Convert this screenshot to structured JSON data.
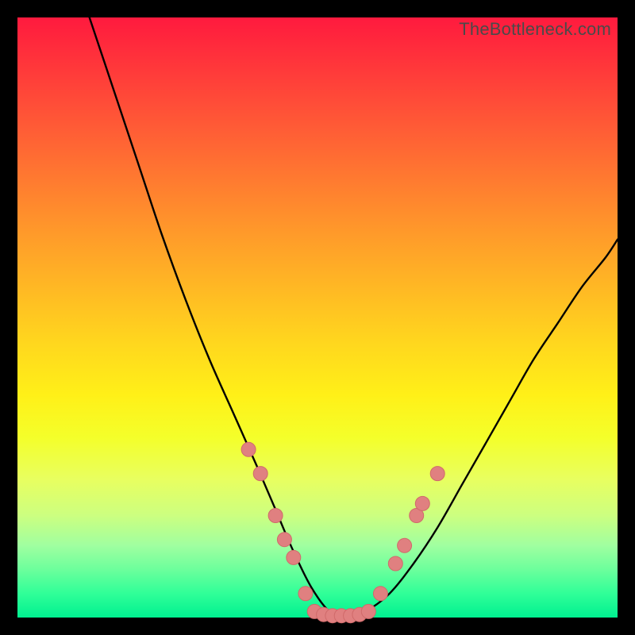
{
  "watermark": "TheBottleneck.com",
  "colors": {
    "curve_stroke": "#000000",
    "marker_fill": "#e08080",
    "marker_stroke": "#d06a6a",
    "frame_bg": "#000000"
  },
  "chart_data": {
    "type": "line",
    "title": "",
    "xlabel": "",
    "ylabel": "",
    "xlim": [
      0,
      100
    ],
    "ylim": [
      0,
      100
    ],
    "series": [
      {
        "name": "bottleneck-curve",
        "x": [
          12,
          16,
          20,
          24,
          28,
          32,
          36,
          40,
          43,
          46,
          49,
          52,
          55,
          58,
          62,
          66,
          70,
          74,
          78,
          82,
          86,
          90,
          94,
          98,
          100
        ],
        "y": [
          100,
          88,
          76,
          64,
          53,
          43,
          34,
          25,
          18,
          11,
          5,
          1,
          0,
          1,
          4,
          9,
          15,
          22,
          29,
          36,
          43,
          49,
          55,
          60,
          63
        ]
      }
    ],
    "markers": [
      {
        "x": 38.5,
        "y": 28
      },
      {
        "x": 40.5,
        "y": 24
      },
      {
        "x": 43.0,
        "y": 17
      },
      {
        "x": 44.5,
        "y": 13
      },
      {
        "x": 46.0,
        "y": 10
      },
      {
        "x": 48.0,
        "y": 4
      },
      {
        "x": 49.5,
        "y": 1
      },
      {
        "x": 51.0,
        "y": 0.5
      },
      {
        "x": 52.5,
        "y": 0.3
      },
      {
        "x": 54.0,
        "y": 0.3
      },
      {
        "x": 55.5,
        "y": 0.3
      },
      {
        "x": 57.0,
        "y": 0.5
      },
      {
        "x": 58.5,
        "y": 1
      },
      {
        "x": 60.5,
        "y": 4
      },
      {
        "x": 63.0,
        "y": 9
      },
      {
        "x": 64.5,
        "y": 12
      },
      {
        "x": 66.5,
        "y": 17
      },
      {
        "x": 67.5,
        "y": 19
      },
      {
        "x": 70.0,
        "y": 24
      }
    ]
  }
}
